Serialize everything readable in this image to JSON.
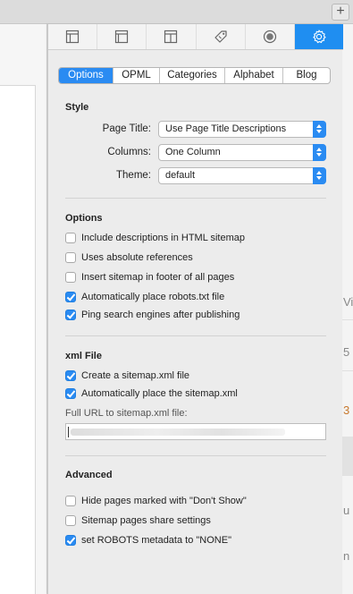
{
  "toolbar": {
    "buttons": [
      {
        "icon": "layout-sidebar-icon",
        "active": false
      },
      {
        "icon": "layout-column-icon",
        "active": false
      },
      {
        "icon": "layout-header-icon",
        "active": false
      },
      {
        "icon": "tag-icon",
        "active": false
      },
      {
        "icon": "target-icon",
        "active": false
      },
      {
        "icon": "sitemap-gear-icon",
        "active": true
      }
    ],
    "accent_color": "#1f8ef1"
  },
  "tabs": {
    "items": [
      "Options",
      "OPML",
      "Categories",
      "Alphabet",
      "Blog"
    ],
    "selected": "Options"
  },
  "style": {
    "title": "Style",
    "page_title_label": "Page Title:",
    "page_title_value": "Use Page Title Descriptions",
    "columns_label": "Columns:",
    "columns_value": "One Column",
    "theme_label": "Theme:",
    "theme_value": "default"
  },
  "options": {
    "title": "Options",
    "items": [
      {
        "label": "Include descriptions in HTML sitemap",
        "checked": false
      },
      {
        "label": "Uses absolute references",
        "checked": false
      },
      {
        "label": "Insert sitemap in footer of all pages",
        "checked": false
      },
      {
        "label": "Automatically place robots.txt file",
        "checked": true
      },
      {
        "label": "Ping search engines after publishing",
        "checked": true
      }
    ]
  },
  "xml_file": {
    "title": "xml File",
    "items": [
      {
        "label": "Create a sitemap.xml file",
        "checked": true
      },
      {
        "label": "Automatically place the sitemap.xml",
        "checked": true
      }
    ],
    "url_label": "Full URL to sitemap.xml file:",
    "url_value": ""
  },
  "advanced": {
    "title": "Advanced",
    "items": [
      {
        "label": "Hide pages marked with \"Don't Show\"",
        "checked": false
      },
      {
        "label": "Sitemap pages share settings",
        "checked": false
      },
      {
        "label": "set ROBOTS metadata to \"NONE\"",
        "checked": true
      }
    ]
  },
  "background": {
    "plus_label": "+",
    "fragments": [
      "Vi",
      "5",
      "3",
      "u",
      "n"
    ]
  }
}
